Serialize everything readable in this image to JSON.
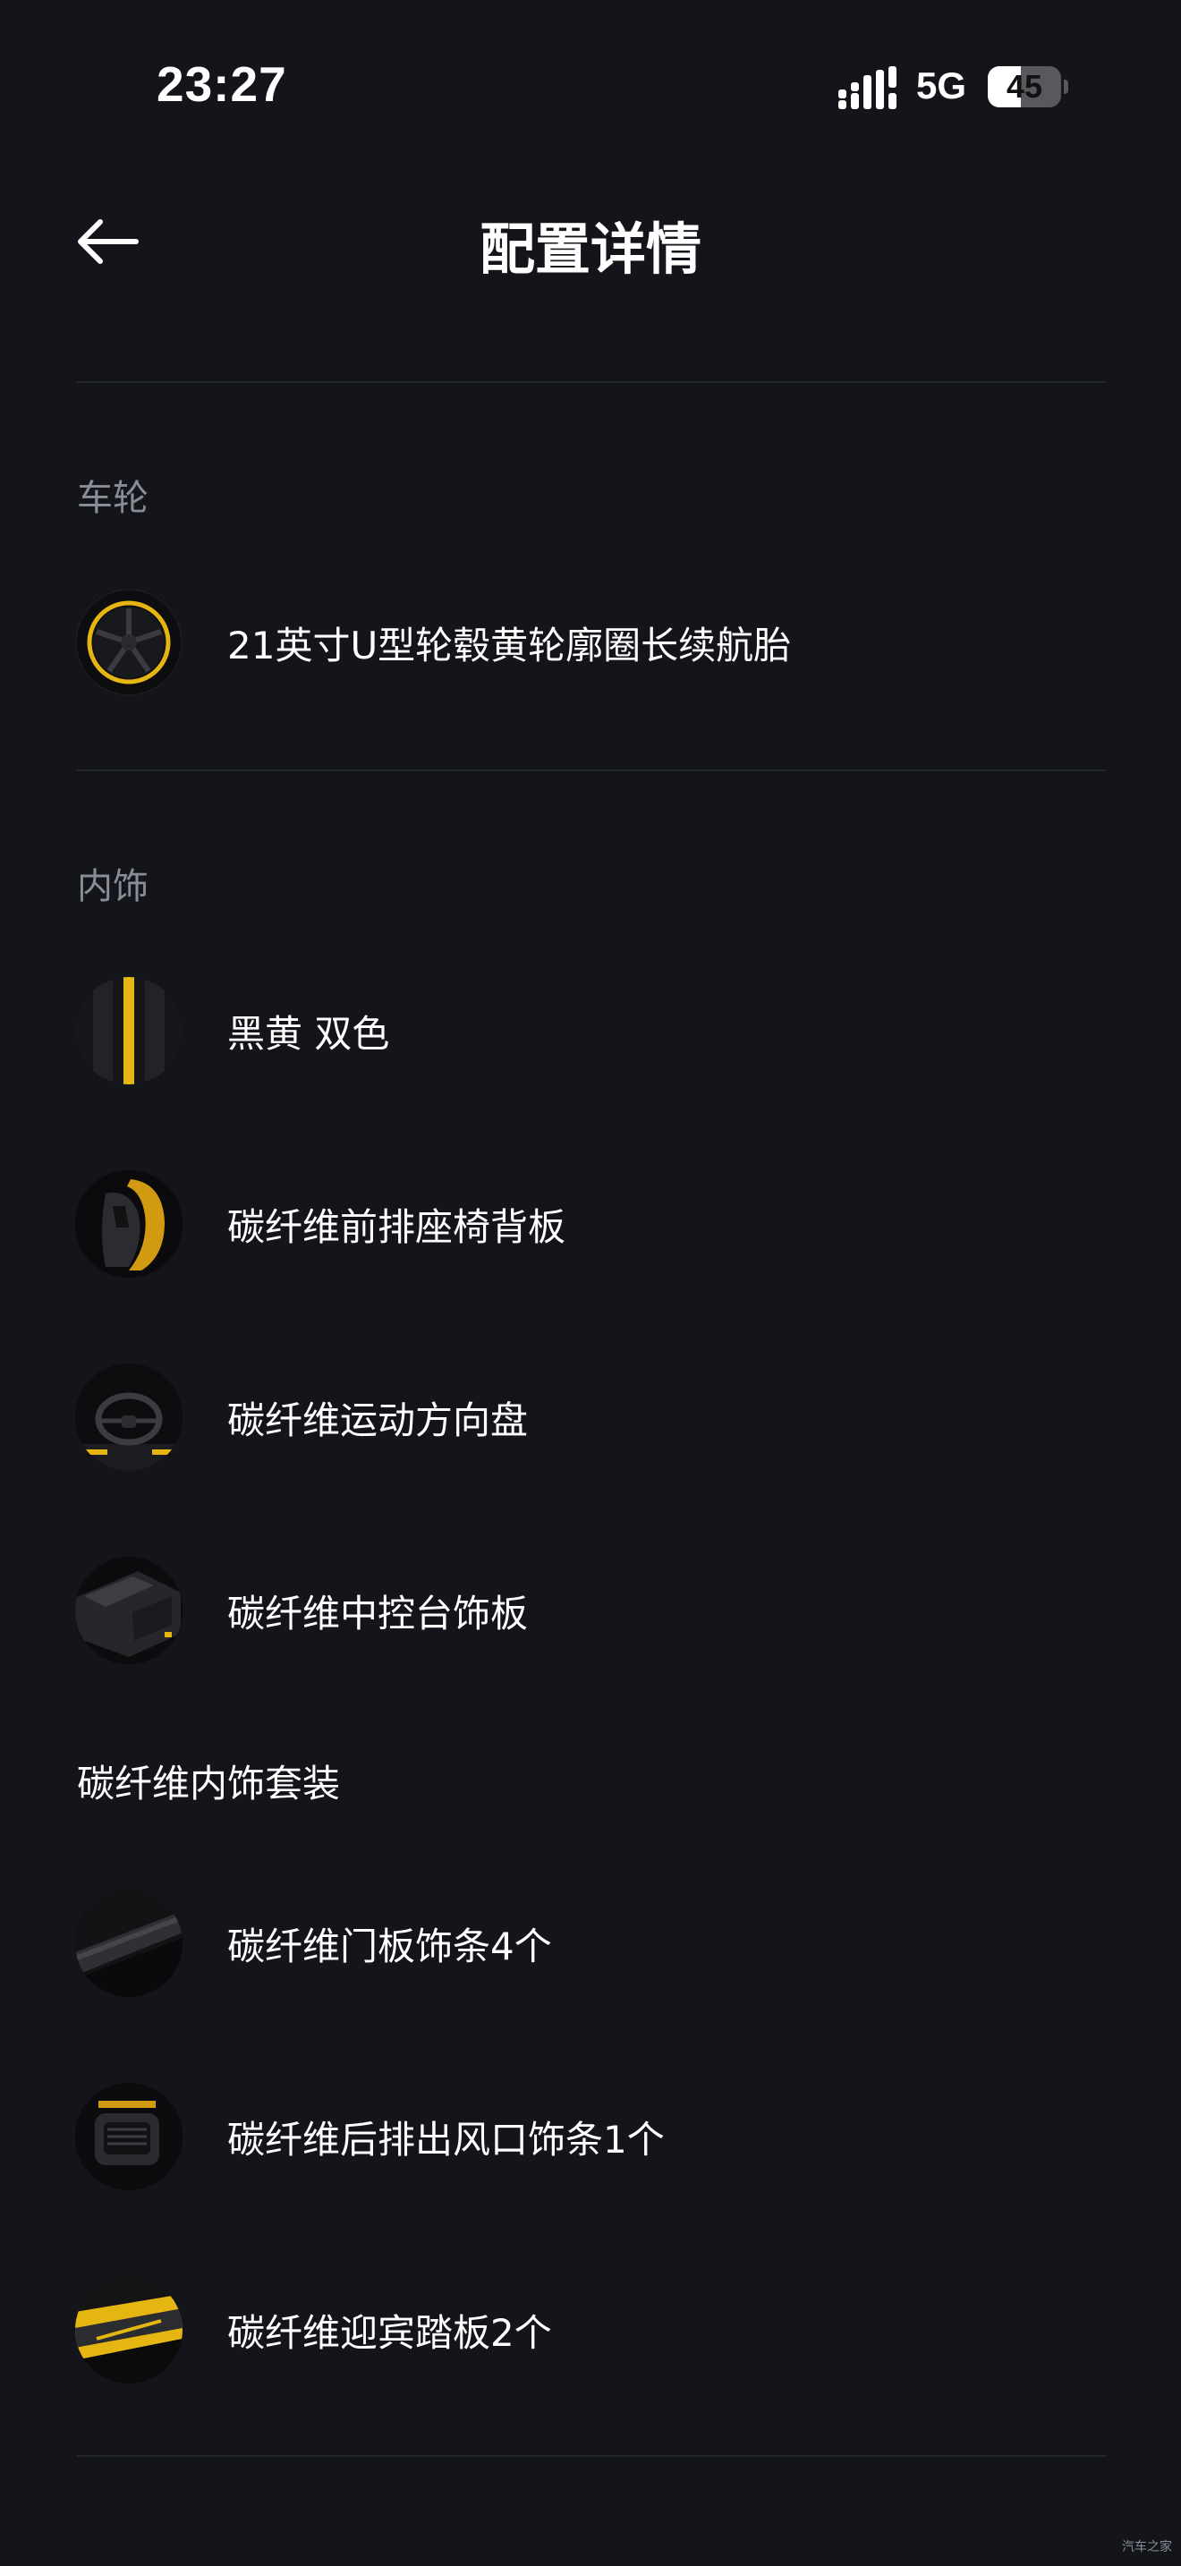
{
  "status_bar": {
    "time": "23:27",
    "network": "5G",
    "battery_level": "45",
    "battery_fraction": 0.45
  },
  "nav": {
    "back_icon": "arrow-left-icon",
    "title": "配置详情"
  },
  "sections": {
    "wheels": {
      "label": "车轮",
      "items": [
        {
          "label": "21英寸U型轮毂黄轮廓圈长续航胎",
          "icon": "wheel-thumbnail"
        }
      ]
    },
    "interior": {
      "label": "内饰",
      "items": [
        {
          "label": "黑黄 双色",
          "icon": "black-yellow-trim-thumbnail"
        },
        {
          "label": "碳纤维前排座椅背板",
          "icon": "seat-back-thumbnail"
        },
        {
          "label": "碳纤维运动方向盘",
          "icon": "steering-wheel-thumbnail"
        },
        {
          "label": "碳纤维中控台饰板",
          "icon": "console-trim-thumbnail"
        }
      ]
    },
    "carbon_package": {
      "label": "碳纤维内饰套装",
      "items": [
        {
          "label": "碳纤维门板饰条4个",
          "icon": "door-trim-thumbnail"
        },
        {
          "label": "碳纤维后排出风口饰条1个",
          "icon": "rear-vent-thumbnail"
        },
        {
          "label": "碳纤维迎宾踏板2个",
          "icon": "sill-plate-thumbnail"
        }
      ]
    }
  },
  "watermark": "汽车之家",
  "colors": {
    "background": "#13151b",
    "divider": "#26282f",
    "section_label": "#8a8d95",
    "accent_yellow": "#e5b512"
  }
}
